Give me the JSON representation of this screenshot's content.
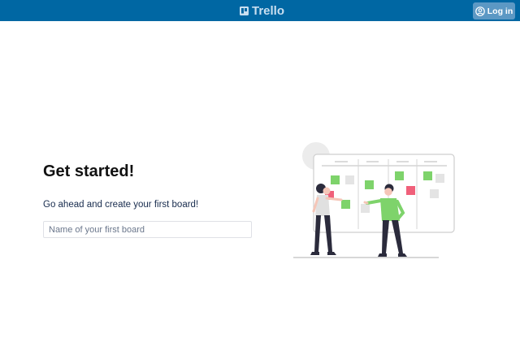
{
  "header": {
    "brand_name": "Trello",
    "login_label": "Log in",
    "background": "#0067a3"
  },
  "main": {
    "heading": "Get started!",
    "subtext": "Go ahead and create your first board!",
    "board_name_input": {
      "value": "",
      "placeholder": "Name of your first board"
    }
  },
  "illustration": {
    "accent_green": "#7ed36b",
    "accent_pink": "#f0607a"
  },
  "icons": {
    "brand": "trello-logo-icon",
    "login": "user-circle-icon"
  }
}
